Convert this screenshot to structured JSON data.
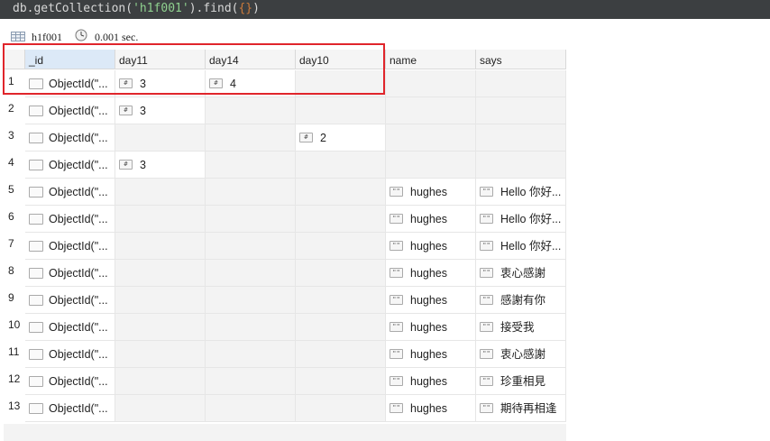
{
  "query": {
    "prefix": "db.getCollection(",
    "arg": "'h1f001'",
    "suffix": ").find(",
    "brace": "{}",
    "end": ")"
  },
  "status": {
    "collection": "h1f001",
    "time": "0.001 sec."
  },
  "columns": [
    "_id",
    "day11",
    "day14",
    "day10",
    "name",
    "says"
  ],
  "rows": [
    {
      "num": "1",
      "id": "ObjectId(\"...",
      "day11": "3",
      "day14": "4",
      "day10": "",
      "name": "",
      "says": ""
    },
    {
      "num": "2",
      "id": "ObjectId(\"...",
      "day11": "3",
      "day14": "",
      "day10": "",
      "name": "",
      "says": ""
    },
    {
      "num": "3",
      "id": "ObjectId(\"...",
      "day11": "",
      "day14": "",
      "day10": "2",
      "name": "",
      "says": ""
    },
    {
      "num": "4",
      "id": "ObjectId(\"...",
      "day11": "3",
      "day14": "",
      "day10": "",
      "name": "",
      "says": ""
    },
    {
      "num": "5",
      "id": "ObjectId(\"...",
      "day11": "",
      "day14": "",
      "day10": "",
      "name": "hughes",
      "says": "Hello 你好..."
    },
    {
      "num": "6",
      "id": "ObjectId(\"...",
      "day11": "",
      "day14": "",
      "day10": "",
      "name": "hughes",
      "says": "Hello 你好..."
    },
    {
      "num": "7",
      "id": "ObjectId(\"...",
      "day11": "",
      "day14": "",
      "day10": "",
      "name": "hughes",
      "says": "Hello 你好..."
    },
    {
      "num": "8",
      "id": "ObjectId(\"...",
      "day11": "",
      "day14": "",
      "day10": "",
      "name": "hughes",
      "says": "衷心感謝"
    },
    {
      "num": "9",
      "id": "ObjectId(\"...",
      "day11": "",
      "day14": "",
      "day10": "",
      "name": "hughes",
      "says": "感謝有你"
    },
    {
      "num": "10",
      "id": "ObjectId(\"...",
      "day11": "",
      "day14": "",
      "day10": "",
      "name": "hughes",
      "says": "接受我"
    },
    {
      "num": "11",
      "id": "ObjectId(\"...",
      "day11": "",
      "day14": "",
      "day10": "",
      "name": "hughes",
      "says": "衷心感謝"
    },
    {
      "num": "12",
      "id": "ObjectId(\"...",
      "day11": "",
      "day14": "",
      "day10": "",
      "name": "hughes",
      "says": "珍重相見"
    },
    {
      "num": "13",
      "id": "ObjectId(\"...",
      "day11": "",
      "day14": "",
      "day10": "",
      "name": "hughes",
      "says": "期待再相逢"
    }
  ],
  "icons": {
    "number_tag": "#",
    "string_tag": "\"\"",
    "object_tag": "object-icon",
    "collection": "table-icon",
    "clock": "clock-icon"
  },
  "colors": {
    "query_bg": "#3c3f41",
    "highlight": "#e0252b",
    "header_active": "#dce9f7",
    "empty_cell": "#f3f3f3"
  }
}
